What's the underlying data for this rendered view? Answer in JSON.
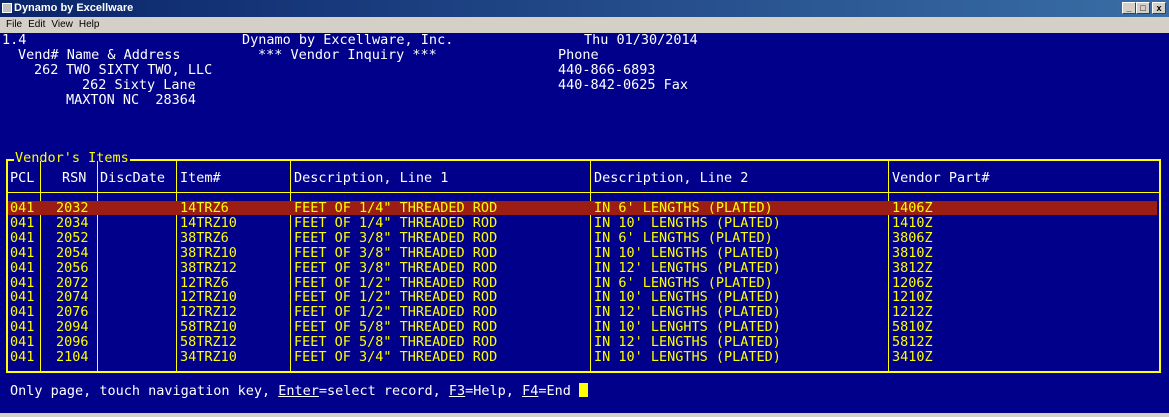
{
  "window": {
    "title": "Dynamo by Excellware",
    "buttons": [
      "_",
      "□",
      "x"
    ]
  },
  "menu": [
    "File",
    "Edit",
    "View",
    "Help"
  ],
  "header": {
    "version": "1.4",
    "company": "Dynamo by Excellware, Inc.",
    "screen_title": "*** Vendor Inquiry ***",
    "date": "Thu 01/30/2014",
    "vend_label": "Vend# Name & Address",
    "phone_label": "Phone"
  },
  "vendor": {
    "number": "262",
    "name": "TWO SIXTY TWO, LLC",
    "address1": "262 Sixty Lane",
    "address2": "MAXTON NC  28364",
    "phone": "440-866-6893",
    "fax": "440-842-0625 Fax"
  },
  "items_panel": {
    "title": "Vendor's Items",
    "columns": [
      "PCL",
      "RSN",
      "DiscDate",
      "Item#",
      "Description, Line 1",
      "Description, Line 2",
      "Vendor Part#"
    ],
    "rows": [
      {
        "pcl": "041",
        "rsn": "2032",
        "disc": "",
        "item": "14TRZ6",
        "d1": "FEET OF 1/4\" THREADED ROD",
        "d2": "IN 6' LENGTHS (PLATED)",
        "part": "1406Z"
      },
      {
        "pcl": "041",
        "rsn": "2034",
        "disc": "",
        "item": "14TRZ10",
        "d1": "FEET OF 1/4\" THREADED ROD",
        "d2": "IN 10' LENGTHS (PLATED)",
        "part": "1410Z"
      },
      {
        "pcl": "041",
        "rsn": "2052",
        "disc": "",
        "item": "38TRZ6",
        "d1": "FEET OF 3/8\" THREADED ROD",
        "d2": "IN 6' LENGTHS (PLATED)",
        "part": "3806Z"
      },
      {
        "pcl": "041",
        "rsn": "2054",
        "disc": "",
        "item": "38TRZ10",
        "d1": "FEET OF 3/8\" THREADED ROD",
        "d2": "IN 10' LENGTHS (PLATED)",
        "part": "3810Z"
      },
      {
        "pcl": "041",
        "rsn": "2056",
        "disc": "",
        "item": "38TRZ12",
        "d1": "FEET OF 3/8\" THREADED ROD",
        "d2": "IN 12' LENGTHS (PLATED)",
        "part": "3812Z"
      },
      {
        "pcl": "041",
        "rsn": "2072",
        "disc": "",
        "item": "12TRZ6",
        "d1": "FEET OF 1/2\" THREADED ROD",
        "d2": "IN 6' LENGTHS (PLATED)",
        "part": "1206Z"
      },
      {
        "pcl": "041",
        "rsn": "2074",
        "disc": "",
        "item": "12TRZ10",
        "d1": "FEET OF 1/2\" THREADED ROD",
        "d2": "IN 10' LENGTHS (PLATED)",
        "part": "1210Z"
      },
      {
        "pcl": "041",
        "rsn": "2076",
        "disc": "",
        "item": "12TRZ12",
        "d1": "FEET OF 1/2\" THREADED ROD",
        "d2": "IN 12' LENGTHS (PLATED)",
        "part": "1212Z"
      },
      {
        "pcl": "041",
        "rsn": "2094",
        "disc": "",
        "item": "58TRZ10",
        "d1": "FEET OF 5/8\" THREADED ROD",
        "d2": "IN 10' LENGHTS (PLATED)",
        "part": "5810Z"
      },
      {
        "pcl": "041",
        "rsn": "2096",
        "disc": "",
        "item": "58TRZ12",
        "d1": "FEET OF 5/8\" THREADED ROD",
        "d2": "IN 12' LENGTHS (PLATED)",
        "part": "5812Z"
      },
      {
        "pcl": "041",
        "rsn": "2104",
        "disc": "",
        "item": "34TRZ10",
        "d1": "FEET OF 3/4\" THREADED ROD",
        "d2": "IN 10' LENGTHS (PLATED)",
        "part": "3410Z"
      }
    ]
  },
  "status": {
    "prefix": "Only page, touch navigation key, ",
    "enter_key": "Enter",
    "enter_text": "=select record, ",
    "f3_key": "F3",
    "f3_text": "=Help, ",
    "f4_key": "F4",
    "f4_text": "=End "
  },
  "colors": {
    "console_bg": "#00008b",
    "accent": "#ffff00",
    "selection": "#9b1d14",
    "text": "#ffffff"
  }
}
